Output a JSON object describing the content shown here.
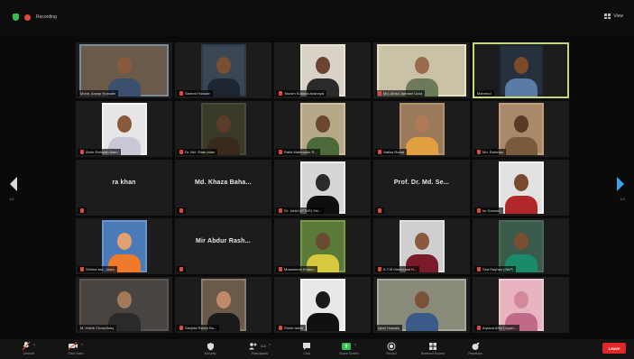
{
  "topbar": {
    "recording_label": "Recording",
    "view_label": "View"
  },
  "colors": {
    "speaker_outline": "#c9d86b",
    "mic_muted": "#e5483a",
    "end_button": "#e02828",
    "nav_arrow_right": "#3aa0e8"
  },
  "pager": {
    "prev_page": "1/4",
    "next_page": "1/4"
  },
  "participants": [
    {
      "caption": "Mohd. Anwar Hossain",
      "display_name": "",
      "video": true,
      "speaking": false,
      "muted": false
    },
    {
      "caption": "Samrat Hossain",
      "display_name": "",
      "video": true,
      "speaking": false,
      "muted": true
    },
    {
      "caption": "Tasnim Sultana Anannya",
      "display_name": "",
      "video": true,
      "speaking": false,
      "muted": true
    },
    {
      "caption": "Md. Abdul Jamaan Uzza",
      "display_name": "",
      "video": true,
      "speaking": false,
      "muted": true
    },
    {
      "caption": "Mahmud",
      "display_name": "",
      "video": true,
      "speaking": true,
      "muted": false
    },
    {
      "caption": "Abhir Rahman Alam",
      "display_name": "",
      "video": true,
      "speaking": false,
      "muted": true
    },
    {
      "caption": "Dr. Md. Shah Alam",
      "display_name": "",
      "video": true,
      "speaking": false,
      "muted": true
    },
    {
      "caption": "Rafid Mahmudur R...",
      "display_name": "",
      "video": true,
      "speaking": false,
      "muted": true
    },
    {
      "caption": "Nafisa Rahat",
      "display_name": "",
      "video": true,
      "speaking": false,
      "muted": true
    },
    {
      "caption": "Md. Rahman",
      "display_name": "",
      "video": true,
      "speaking": false,
      "muted": true
    },
    {
      "caption": "",
      "display_name": "ra khan",
      "video": false,
      "speaking": false,
      "muted": true
    },
    {
      "caption": "",
      "display_name": "Md. Khaza Baha...",
      "video": false,
      "speaking": false,
      "muted": true
    },
    {
      "caption": "Dr. Jahid (IPTAR) Shi...",
      "display_name": "",
      "video": true,
      "speaking": false,
      "muted": true
    },
    {
      "caption": "",
      "display_name": "Prof. Dr. Md. Se...",
      "video": false,
      "speaking": false,
      "muted": true
    },
    {
      "caption": "Isr Gonesh",
      "display_name": "",
      "video": true,
      "speaking": false,
      "muted": true
    },
    {
      "caption": "Shirina ara - Alam",
      "display_name": "",
      "video": true,
      "speaking": false,
      "muted": true
    },
    {
      "caption": "",
      "display_name": "Mir Abdur Rash...",
      "video": false,
      "speaking": false,
      "muted": true
    },
    {
      "caption": "Mosammat Khatun",
      "display_name": "",
      "video": true,
      "speaking": false,
      "muted": true
    },
    {
      "caption": "A.T.M Mahmudul H...",
      "display_name": "",
      "video": true,
      "speaking": false,
      "muted": true
    },
    {
      "caption": "Sha Rayhan (IIWP)",
      "display_name": "",
      "video": true,
      "speaking": false,
      "muted": true
    },
    {
      "caption": "M. Habib Chowdhury",
      "display_name": "",
      "video": true,
      "speaking": false,
      "muted": false
    },
    {
      "caption": "Sanjida Rahim Bu...",
      "display_name": "",
      "video": true,
      "speaking": false,
      "muted": true
    },
    {
      "caption": "Shirin Islam",
      "display_name": "",
      "video": true,
      "speaking": false,
      "muted": true
    },
    {
      "caption": "Iqbal Hossain",
      "display_name": "",
      "video": true,
      "speaking": false,
      "muted": false
    },
    {
      "caption": "Arpana Afrin Liyyah...",
      "display_name": "",
      "video": true,
      "speaking": false,
      "muted": true
    }
  ],
  "toolbar": {
    "buttons": [
      {
        "id": "unmute",
        "label": "Unmute",
        "icon": "microphone-muted-icon"
      },
      {
        "id": "video",
        "label": "Start Video",
        "icon": "video-off-icon"
      },
      {
        "id": "security",
        "label": "Security",
        "icon": "shield-icon"
      },
      {
        "id": "participants",
        "label": "Participants",
        "icon": "participants-icon",
        "count": "110"
      },
      {
        "id": "chat",
        "label": "Chat",
        "icon": "chat-icon"
      },
      {
        "id": "share",
        "label": "Share Screen",
        "icon": "share-screen-icon"
      },
      {
        "id": "record",
        "label": "Record",
        "icon": "record-icon"
      },
      {
        "id": "breakout",
        "label": "Breakout Rooms",
        "icon": "breakout-rooms-icon"
      },
      {
        "id": "reactions",
        "label": "Reactions",
        "icon": "reactions-icon"
      }
    ],
    "end_label": "Leave"
  }
}
